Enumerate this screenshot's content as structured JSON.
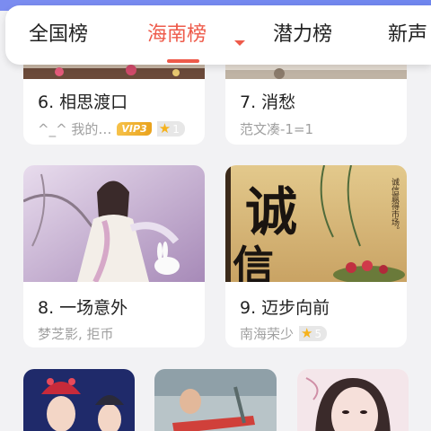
{
  "tabs": [
    {
      "label": "全国榜"
    },
    {
      "label": "海南榜"
    },
    {
      "label": "潜力榜"
    },
    {
      "label": "新声"
    }
  ],
  "cards": [
    {
      "title": "6. 相思渡口",
      "subtitle": "^_^  我的…",
      "badge": "VIP3",
      "rank": "1"
    },
    {
      "title": "7. 消愁",
      "subtitle": "范文凑-1=1"
    },
    {
      "title": "8. 一场意外",
      "subtitle": "梦芝影, 拒币"
    },
    {
      "title": "9. 迈步向前",
      "subtitle": "南海荣少",
      "rank": "5"
    }
  ],
  "thumb_text": {
    "cheng": "诚",
    "xin": "信",
    "calligraphy": "诚信赢得市场。"
  },
  "icons": {
    "caret": "caret-down-icon",
    "star": "star-icon"
  },
  "colors": {
    "accent": "#ee5a4a",
    "vip": "#f0b23a"
  }
}
